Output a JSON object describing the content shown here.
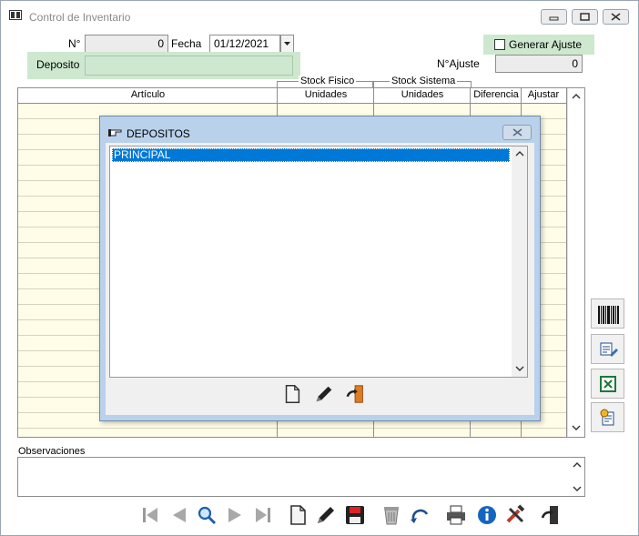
{
  "window": {
    "title": "Control de Inventario"
  },
  "form": {
    "numero_label": "N°",
    "numero_value": "0",
    "fecha_label": "Fecha",
    "fecha_value": "01/12/2021",
    "deposito_label": "Deposito",
    "deposito_value": "",
    "generar_ajuste_label": "Generar Ajuste",
    "generar_ajuste_checked": false,
    "ajuste_label": "N°Ajuste",
    "ajuste_value": "0"
  },
  "grid": {
    "group_headers": [
      "Stock Fisico",
      "Stock Sistema"
    ],
    "columns": [
      "Artículo",
      "Unidades",
      "Unidades",
      "Diferencia",
      "Ajustar"
    ],
    "rows": []
  },
  "observaciones": {
    "label": "Observaciones",
    "value": ""
  },
  "side_buttons": [
    "barcode-icon",
    "edit-document-icon",
    "excel-icon",
    "settings-document-icon"
  ],
  "toolbar": [
    "first-icon",
    "previous-icon",
    "search-icon",
    "next-icon",
    "last-icon",
    "new-icon",
    "edit-icon",
    "save-icon",
    "delete-icon",
    "undo-icon",
    "print-icon",
    "info-icon",
    "tools-icon",
    "exit-icon"
  ],
  "dialog": {
    "title": "DEPOSITOS",
    "items": [
      "PRINCIPAL"
    ],
    "selected_index": 0,
    "buttons": [
      "new-icon",
      "edit-icon",
      "exit-icon"
    ]
  },
  "colors": {
    "green_highlight": "#cde8cf",
    "grid_body": "#fffde8",
    "dialog_bg": "#b9d1ea",
    "selection": "#0078d7"
  }
}
